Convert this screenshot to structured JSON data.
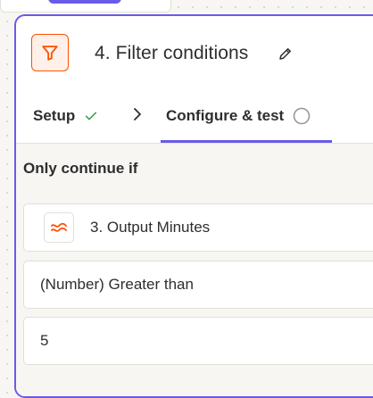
{
  "step": {
    "title": "4. Filter conditions",
    "icon": "filter-icon",
    "accent_color": "#ff4f00",
    "brand_color": "#695be8"
  },
  "tabs": [
    {
      "label": "Setup",
      "status_icon": "check-icon",
      "status_color": "#3ca054"
    },
    {
      "label": "Configure & test",
      "status_icon": "circle-outline-icon",
      "active": true
    }
  ],
  "condition": {
    "section_label": "Only continue if",
    "field": {
      "label": "3. Output Minutes",
      "app_icon": "formatter-icon"
    },
    "operator": "(Number) Greater than",
    "value": "5"
  }
}
